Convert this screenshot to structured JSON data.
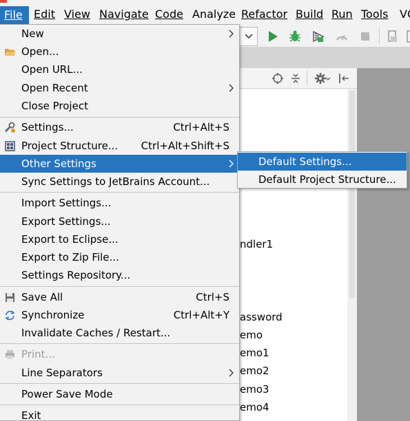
{
  "menubar": {
    "items": [
      "File",
      "Edit",
      "View",
      "Navigate",
      "Code",
      "Analyze",
      "Refactor",
      "Build",
      "Run",
      "Tools",
      "VC"
    ]
  },
  "file_menu": {
    "items": [
      {
        "label": "New",
        "has_submenu": true
      },
      {
        "label": "Open...",
        "icon": "folder-icon"
      },
      {
        "label": "Open URL..."
      },
      {
        "label": "Open Recent",
        "has_submenu": true
      },
      {
        "label": "Close Project"
      },
      {
        "label": "Settings...",
        "shortcut": "Ctrl+Alt+S",
        "icon": "settings-wrench-icon"
      },
      {
        "label": "Project Structure...",
        "shortcut": "Ctrl+Alt+Shift+S",
        "icon": "project-structure-icon"
      },
      {
        "label": "Other Settings",
        "has_submenu": true,
        "highlighted": true
      },
      {
        "label": "Sync Settings to JetBrains Account..."
      },
      {
        "label": "Import Settings..."
      },
      {
        "label": "Export Settings..."
      },
      {
        "label": "Export to Eclipse..."
      },
      {
        "label": "Export to Zip File..."
      },
      {
        "label": "Settings Repository..."
      },
      {
        "label": "Save All",
        "shortcut": "Ctrl+S",
        "icon": "save-icon"
      },
      {
        "label": "Synchronize",
        "shortcut": "Ctrl+Alt+Y",
        "icon": "synchronize-icon"
      },
      {
        "label": "Invalidate Caches / Restart..."
      },
      {
        "label": "Print...",
        "disabled": true,
        "icon": "print-icon"
      },
      {
        "label": "Line Separators",
        "has_submenu": true
      },
      {
        "label": "Power Save Mode"
      },
      {
        "label": "Exit"
      }
    ]
  },
  "submenu": {
    "items": [
      {
        "label": "Default Settings...",
        "highlighted": true
      },
      {
        "label": "Default Project Structure..."
      }
    ]
  },
  "project_tree": {
    "items": [
      "ndler1",
      "assword",
      "emo",
      "emo1",
      "emo2",
      "emo3",
      "emo4"
    ]
  },
  "colors": {
    "highlight": "#2675bf",
    "menu_bg": "#f2f2f2",
    "run_green": "#2f9e44",
    "side_panel_gray": "#9d9d9d"
  }
}
